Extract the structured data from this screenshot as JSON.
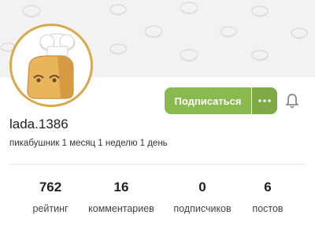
{
  "profile": {
    "username": "lada.1386",
    "tenure": "пикабушник 1 месяц 1 неделю 1 день"
  },
  "actions": {
    "subscribe_label": "Подписаться",
    "more_icon": "more-dots-icon",
    "bell_icon": "bell-icon"
  },
  "stats": [
    {
      "value": "762",
      "label": "рейтинг"
    },
    {
      "value": "16",
      "label": "комментариев"
    },
    {
      "value": "0",
      "label": "подписчиков"
    },
    {
      "value": "6",
      "label": "постов"
    }
  ],
  "colors": {
    "accent_green": "#8ab94e",
    "avatar_border": "#d9a84a",
    "cover_bg": "#f2f2f2"
  }
}
